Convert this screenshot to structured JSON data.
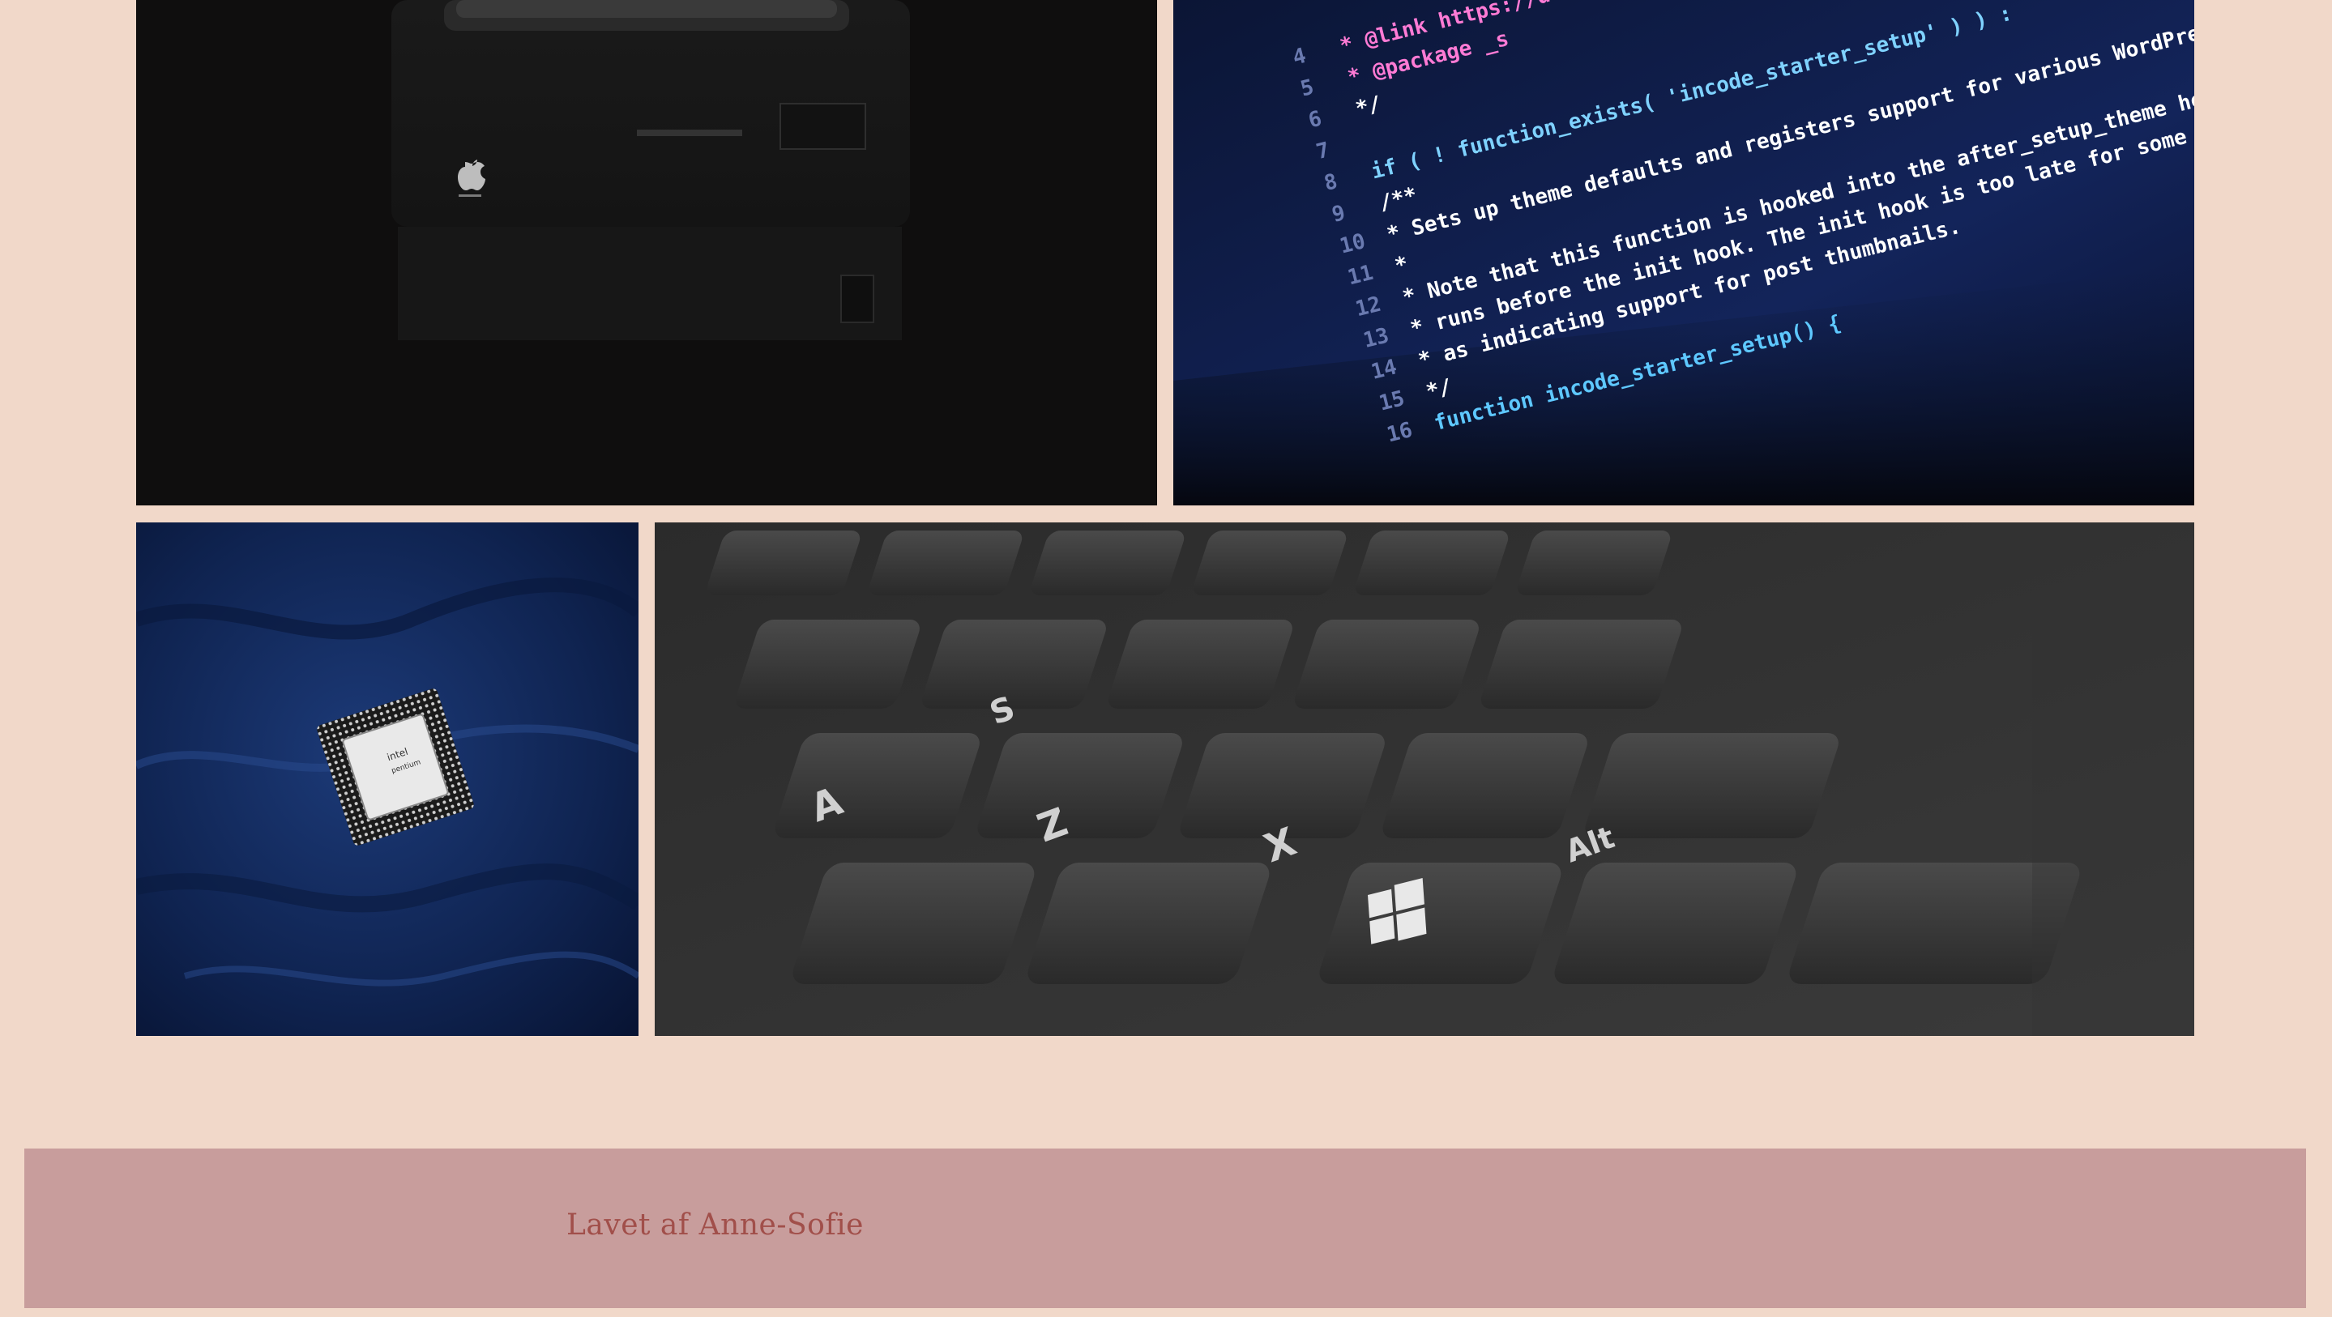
{
  "gallery": {
    "tiles": [
      {
        "id": "mac",
        "subject": "apple-icon"
      },
      {
        "id": "code",
        "subject": "code-editor"
      },
      {
        "id": "chip",
        "subject": "cpu-chip"
      },
      {
        "id": "keyboard",
        "subject": "keyboard"
      }
    ]
  },
  "code_lines": [
    {
      "num": "4",
      "text": "* @link https://de..."
    },
    {
      "num": "5",
      "text": "* @package _s"
    },
    {
      "num": "6",
      "text": "*/"
    },
    {
      "num": "7",
      "text": ""
    },
    {
      "num": "8",
      "text": "if ( ! function_exists( 'incode_starter_setup' ) ) :"
    },
    {
      "num": "9",
      "text": "/**"
    },
    {
      "num": "10",
      "text": " * Sets up theme defaults and registers support for various WordPress features."
    },
    {
      "num": "11",
      "text": " *"
    },
    {
      "num": "12",
      "text": " * Note that this function is hooked into the after_setup_theme hook, which"
    },
    {
      "num": "13",
      "text": " * runs before the init hook. The init hook is too late for some features, such"
    },
    {
      "num": "14",
      "text": " * as indicating support for post thumbnails."
    },
    {
      "num": "15",
      "text": " */"
    },
    {
      "num": "16",
      "text": "function incode_starter_setup() {"
    }
  ],
  "chip": {
    "brand": "intel",
    "model": "pentium"
  },
  "keyboard": {
    "keys": [
      "A",
      "Z",
      "X",
      "S",
      "Alt"
    ]
  },
  "footer": {
    "credit": "Lavet af Anne-Sofie"
  },
  "colors": {
    "page_bg": "#f1d8c9",
    "footer_bg": "#c89d9c",
    "footer_text": "#a14f4a"
  }
}
